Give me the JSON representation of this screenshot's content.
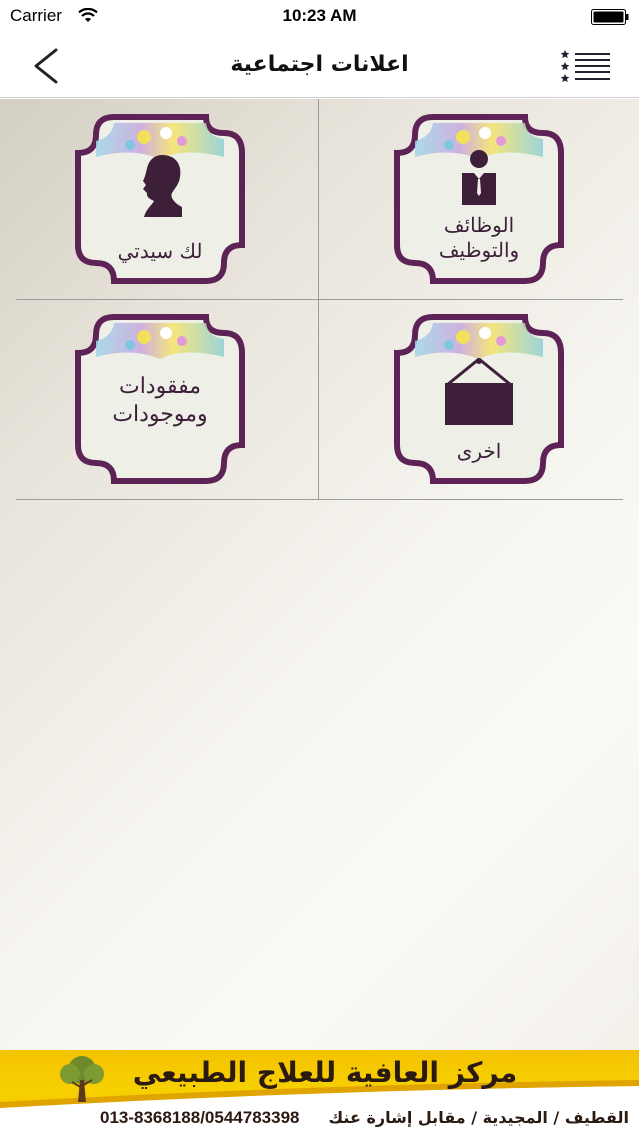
{
  "status_bar": {
    "carrier": "Carrier",
    "time": "10:23 AM",
    "wifi_icon": "wifi-icon",
    "battery_icon": "battery-full-icon"
  },
  "nav": {
    "title": "اعلانات اجتماعية",
    "back_icon": "chevron-left-icon",
    "menu_icon": "star-list-menu-icon"
  },
  "tiles": [
    {
      "label": "الوظائف والتوظيف",
      "icon": "businessman-icon"
    },
    {
      "label": "لك سيدتي",
      "icon": "woman-silhouette-icon"
    },
    {
      "label": "اخرى",
      "icon": "hanging-sign-icon"
    },
    {
      "label": "مفقودات وموجودات",
      "icon": "none"
    }
  ],
  "footer": {
    "title": "مركز العافية للعلاج الطبيعي",
    "address": "القطيف / المجيدية / مقابل إشارة عنك",
    "phone": "013-8368188/0544783398",
    "logo_icon": "tree-logo-icon"
  },
  "colors": {
    "tile_border": "#5e2356",
    "tile_inner": "#eef0e8",
    "label_text": "#3e1f3a",
    "footer_bg": "#f5c800"
  }
}
